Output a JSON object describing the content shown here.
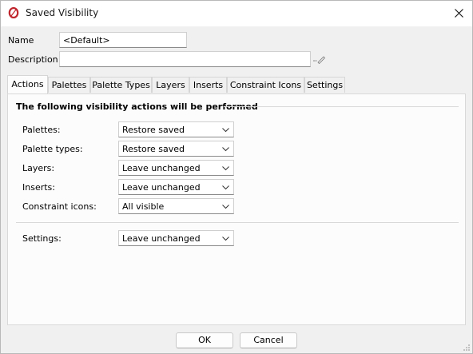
{
  "window": {
    "title": "Saved Visibility",
    "accent_color": "#c0262d"
  },
  "form": {
    "name_label": "Name",
    "name_value": "<Default>",
    "description_label": "Description",
    "description_value": ""
  },
  "tabs": [
    {
      "label": "Actions",
      "active": true
    },
    {
      "label": "Palettes",
      "active": false
    },
    {
      "label": "Palette Types",
      "active": false
    },
    {
      "label": "Layers",
      "active": false
    },
    {
      "label": "Inserts",
      "active": false
    },
    {
      "label": "Constraint Icons",
      "active": false
    },
    {
      "label": "Settings",
      "active": false
    }
  ],
  "panel": {
    "section_title": "The following visibility actions will be performed",
    "rows": [
      {
        "label": "Palettes:",
        "value": "Restore saved"
      },
      {
        "label": "Palette types:",
        "value": "Restore saved"
      },
      {
        "label": "Layers:",
        "value": "Leave unchanged"
      },
      {
        "label": "Inserts:",
        "value": "Leave unchanged"
      },
      {
        "label": "Constraint icons:",
        "value": "All visible"
      }
    ],
    "settings_row": {
      "label": "Settings:",
      "value": "Leave unchanged"
    }
  },
  "buttons": {
    "ok": "OK",
    "cancel": "Cancel"
  },
  "icons": {
    "app": "app-ring-icon",
    "close": "close-icon",
    "ellipsis": "pen-ellipsis-icon",
    "dropdown": "chevron-down-icon",
    "grip": "resize-grip-icon"
  }
}
